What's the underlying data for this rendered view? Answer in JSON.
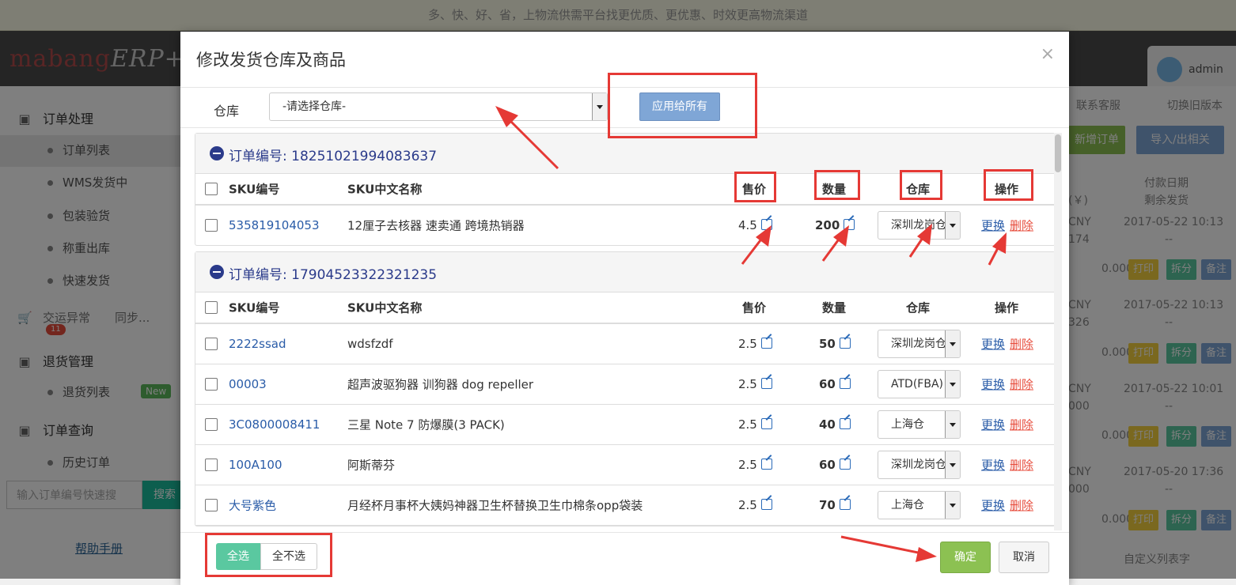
{
  "banner": {
    "text": "多、快、好、省，上物流供需平台找更优质、更优惠、时效更高物流渠道"
  },
  "app": {
    "logo": "mabang",
    "logo_suffix": "ERP+",
    "user": "admin"
  },
  "sidebar": {
    "sec_orders": "订单处理",
    "items": [
      "订单列表",
      "WMS发货中",
      "包装验货",
      "称重出库",
      "快速发货"
    ],
    "tab_exception": "交运异常",
    "tab_exception_count": "11",
    "tab_sync": "同步...",
    "sec_returns": "退货管理",
    "returns_item": "退货列表",
    "new_badge": "New",
    "sec_query": "订单查询",
    "history_item": "历史订单",
    "search_placeholder": "输入订单编号快速搜",
    "search_btn": "搜索",
    "help": "帮助手册"
  },
  "right": {
    "contact": "联系客服",
    "switch_old": "切换旧版本",
    "new_order": "新增订单",
    "import_export": "导入/出相关",
    "col_pay_date": "付款日期",
    "col_remain": "剩余发货",
    "col_currency": "(￥)",
    "rows": [
      {
        "cur": "CNY",
        "num": "174",
        "date": "2017-05-22 10:13",
        "dash": "--",
        "amt": "0.000"
      },
      {
        "cur": "CNY",
        "num": "326",
        "date": "2017-05-22 10:13",
        "dash": "--",
        "amt": "0.000"
      },
      {
        "cur": "CNY",
        "num": "000",
        "date": "2017-05-22 10:01",
        "dash": "--",
        "amt": "0.000"
      },
      {
        "cur": "CNY",
        "num": "000",
        "date": "2017-05-20 17:36",
        "dash": "--",
        "amt": "0.000"
      }
    ],
    "btn_print": "打印",
    "btn_split": "拆分",
    "btn_note": "备注",
    "custom_cols": "自定义列表字"
  },
  "modal": {
    "title": "修改发货仓库及商品",
    "close": "×",
    "warehouse_label": "仓库",
    "warehouse_placeholder": "-请选择仓库-",
    "apply_all": "应用给所有",
    "col_sku": "SKU编号",
    "col_name": "SKU中文名称",
    "col_price": "售价",
    "col_qty": "数量",
    "col_wh": "仓库",
    "col_op": "操作",
    "op_change": "更换",
    "op_delete": "删除",
    "select_all": "全选",
    "select_none": "全不选",
    "confirm": "确定",
    "cancel": "取消",
    "order_prefix": "订单编号: ",
    "orders": [
      {
        "order_no": "18251021994083637",
        "items": [
          {
            "sku": "535819104053",
            "name": "12厘子去核器 速卖通 跨境热销器",
            "price": "4.5",
            "qty": "200",
            "wh": "深圳龙岗仓"
          }
        ]
      },
      {
        "order_no": "17904523322321235",
        "items": [
          {
            "sku": "2222ssad",
            "name": "wdsfzdf",
            "price": "2.5",
            "qty": "50",
            "wh": "深圳龙岗仓"
          },
          {
            "sku": "00003",
            "name": "超声波驱狗器 训狗器 dog repeller",
            "price": "2.5",
            "qty": "60",
            "wh": "ATD(FBA)"
          },
          {
            "sku": "3C0800008411",
            "name": "三星 Note 7 防爆膜(3 PACK)",
            "price": "2.5",
            "qty": "40",
            "wh": "上海仓"
          },
          {
            "sku": "100A100",
            "name": "阿斯蒂芬",
            "price": "2.5",
            "qty": "60",
            "wh": "深圳龙岗仓"
          },
          {
            "sku": "大号紫色",
            "name": "月经杯月事杯大姨妈神器卫生杯替换卫生巾棉条opp袋装",
            "price": "2.5",
            "qty": "70",
            "wh": "上海仓"
          }
        ]
      }
    ]
  },
  "colors": {
    "accent_blue": "#2a5ca8",
    "annotation_red": "#e53935",
    "confirm_green": "#8cc152",
    "select_all_teal": "#5ac8a0"
  }
}
